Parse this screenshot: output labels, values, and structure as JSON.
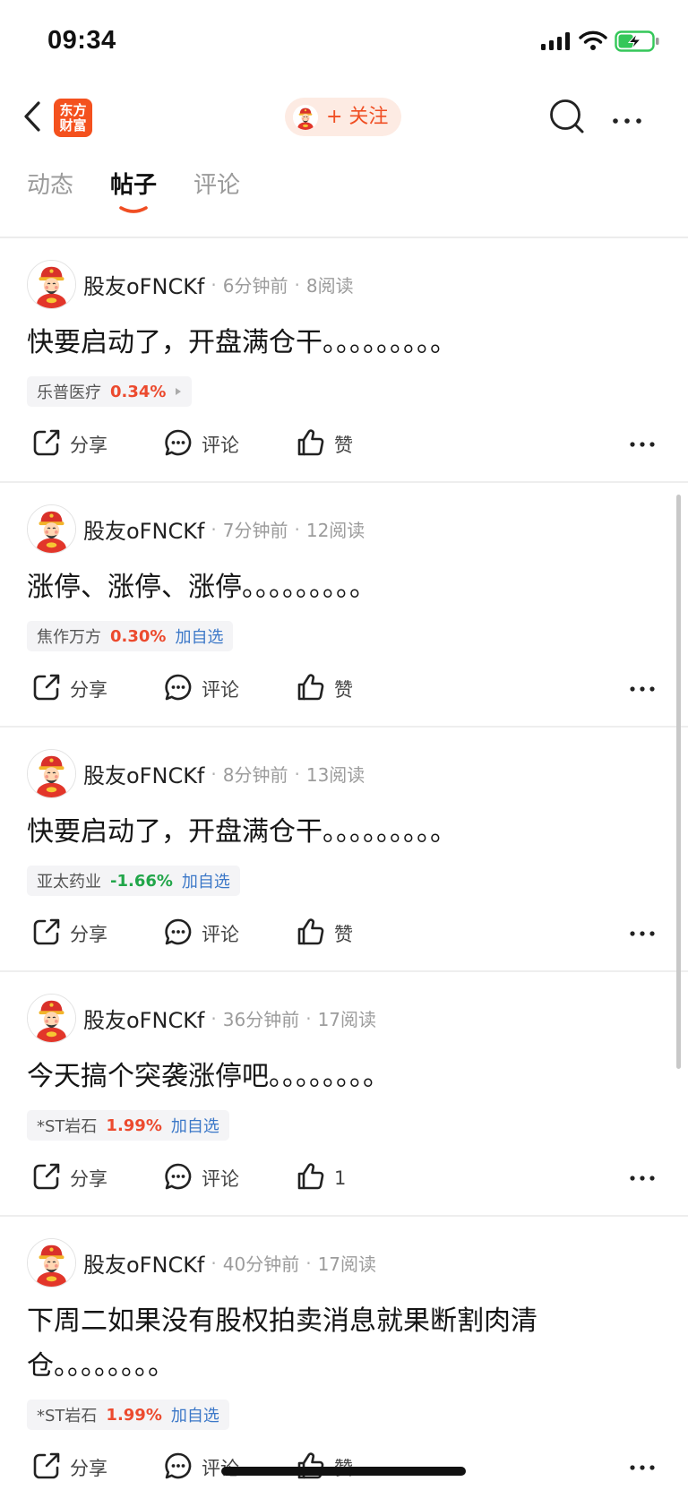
{
  "status_bar": {
    "time": "09:34",
    "battery_level": 0.45,
    "charging": true,
    "icons": [
      "signal-icon",
      "wifi-icon",
      "battery-icon"
    ]
  },
  "header": {
    "logo_lines": [
      "东方",
      "财富"
    ],
    "follow_label": "+ 关注",
    "icons": [
      "back-icon",
      "search-icon",
      "more-icon"
    ]
  },
  "tabs": [
    {
      "label": "动态",
      "active": false
    },
    {
      "label": "帖子",
      "active": true
    },
    {
      "label": "评论",
      "active": false
    }
  ],
  "meta_separator": "·",
  "colors": {
    "accent": "#f04e23",
    "rise": "#ec4a2e",
    "fall": "#22a64a",
    "link": "#3c78c8"
  },
  "posts": [
    {
      "user": "股友oFNCKf",
      "time": "6分钟前",
      "reads": "8阅读",
      "content": "快要启动了，开盘满仓干。。。。。。。。。",
      "stock": {
        "name": "乐普医疗",
        "change": "0.34%",
        "trend": "rise",
        "trailing_icon": "caret-right-icon"
      },
      "actions": {
        "share": "分享",
        "comment": "评论",
        "like": "赞"
      }
    },
    {
      "user": "股友oFNCKf",
      "time": "7分钟前",
      "reads": "12阅读",
      "content": "涨停、涨停、涨停。。。。。。。。。",
      "stock": {
        "name": "焦作万方",
        "change": "0.30%",
        "trend": "rise",
        "add_label": "加自选"
      },
      "actions": {
        "share": "分享",
        "comment": "评论",
        "like": "赞"
      }
    },
    {
      "user": "股友oFNCKf",
      "time": "8分钟前",
      "reads": "13阅读",
      "content": "快要启动了，开盘满仓干。。。。。。。。。",
      "stock": {
        "name": "亚太药业",
        "change": "-1.66%",
        "trend": "fall",
        "add_label": "加自选"
      },
      "actions": {
        "share": "分享",
        "comment": "评论",
        "like": "赞"
      }
    },
    {
      "user": "股友oFNCKf",
      "time": "36分钟前",
      "reads": "17阅读",
      "content": "今天搞个突袭涨停吧。。。。。。。。",
      "stock": {
        "name": "*ST岩石",
        "change": "1.99%",
        "trend": "rise",
        "add_label": "加自选"
      },
      "actions": {
        "share": "分享",
        "comment": "评论",
        "like": "1"
      }
    },
    {
      "user": "股友oFNCKf",
      "time": "40分钟前",
      "reads": "17阅读",
      "content": "下周二如果没有股权拍卖消息就果断割肉清仓。。。。。。。。",
      "stock": {
        "name": "*ST岩石",
        "change": "1.99%",
        "trend": "rise",
        "add_label": "加自选"
      },
      "actions": {
        "share": "分享",
        "comment": "评论",
        "like": "赞"
      }
    }
  ]
}
